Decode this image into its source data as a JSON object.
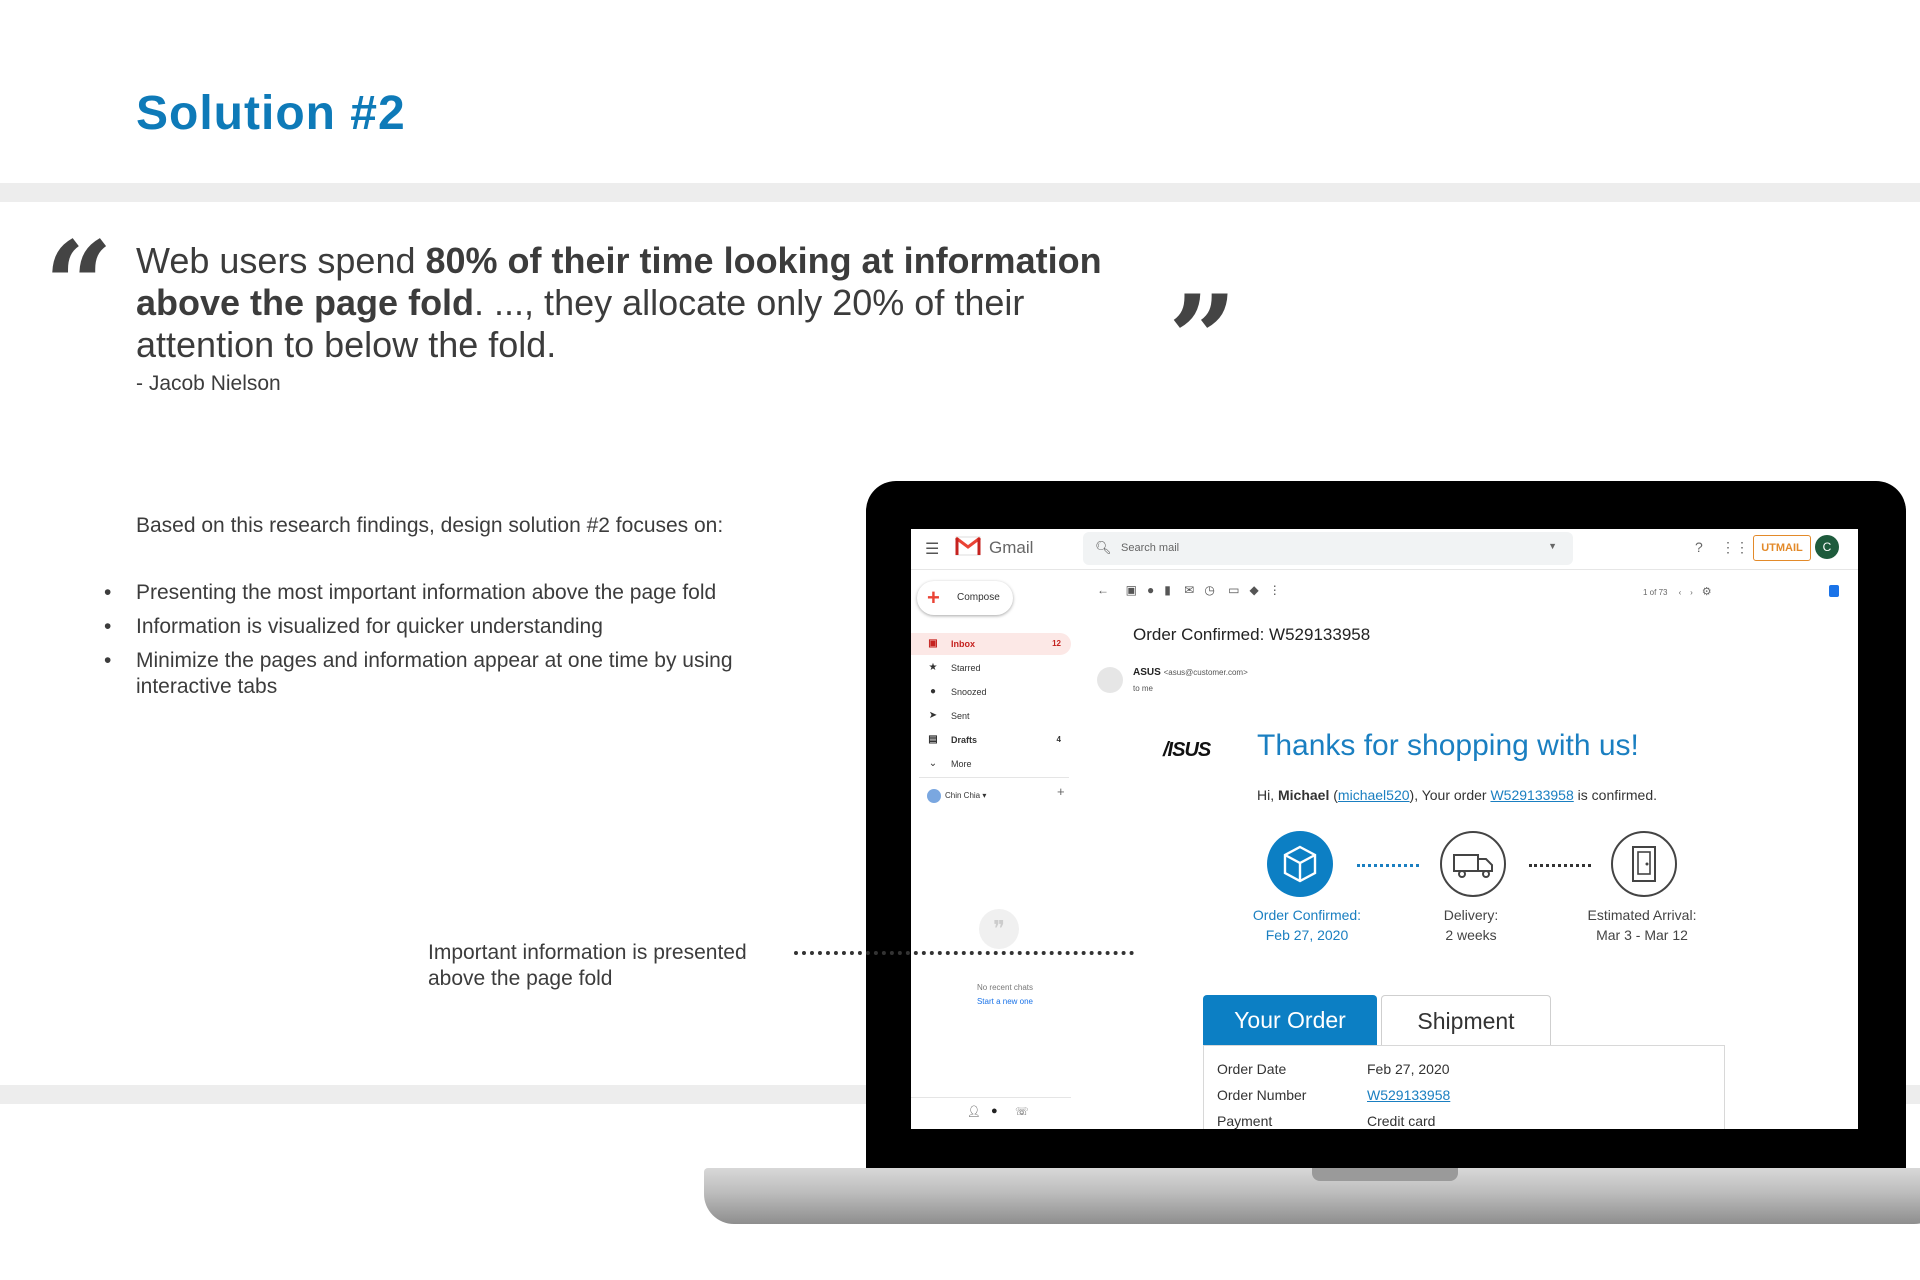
{
  "slide": {
    "title": "Solution #2",
    "quote_open": "“",
    "quote_close": "”",
    "quote": {
      "p1": "Web users spend ",
      "b1": "80% of their time looking at information above the page fold",
      "p2": ". ..., they allocate only 20% of their attention to below the fold."
    },
    "author": "- Jacob Nielson",
    "intro": "Based on this research findings, design solution #2 focuses on:",
    "bullet_glyph": "•",
    "bullets": [
      "Presenting the most important information above the page fold",
      "Information is visualized for quicker understanding",
      "Minimize the pages and information appear at one time by using interactive tabs"
    ],
    "callout": "Important information is presented above the page fold",
    "colors": {
      "title": "#0e7ab8",
      "band": "#ededed",
      "accent": "#0c7fc4"
    }
  },
  "gmail": {
    "app_name": "Gmail",
    "search_placeholder": "Search mail",
    "utm_badge": "UTMAIL",
    "avatar_letter": "C",
    "compose": "Compose",
    "nav": [
      {
        "label": "Inbox",
        "count": "12",
        "icon": "inbox-icon"
      },
      {
        "label": "Starred",
        "count": "",
        "icon": "star-icon"
      },
      {
        "label": "Snoozed",
        "count": "",
        "icon": "clock-icon"
      },
      {
        "label": "Sent",
        "count": "",
        "icon": "send-icon"
      },
      {
        "label": "Drafts",
        "count": "4",
        "icon": "draft-icon"
      },
      {
        "label": "More",
        "count": "",
        "icon": "chevron-down-icon"
      }
    ],
    "account": "Chin Chia",
    "no_chats": "No recent chats",
    "start_chat": "Start a new one",
    "pager": "1 of 73",
    "subject": "Order Confirmed: W529133958",
    "sender_name": "ASUS",
    "sender_addr": "<asus@customer.com>",
    "to": "to me"
  },
  "email": {
    "brand": "/ISUS",
    "headline": "Thanks for shopping with us!",
    "greet_pre": "Hi, ",
    "greet_name": "Michael",
    "greet_user": "michael520",
    "greet_mid": "), Your order ",
    "order_no": "W529133958",
    "greet_post": " is confirmed.",
    "steps": [
      {
        "label": "Order Confirmed:",
        "value": "Feb 27, 2020",
        "icon": "package-icon",
        "done": true
      },
      {
        "label": "Delivery:",
        "value": "2 weeks",
        "icon": "truck-icon",
        "done": false
      },
      {
        "label": "Estimated Arrival:",
        "value": "Mar 3 - Mar 12",
        "icon": "door-icon",
        "done": false
      }
    ],
    "tabs": [
      "Your Order",
      "Shipment"
    ],
    "rows": [
      {
        "label": "Order Date",
        "value": "Feb 27, 2020"
      },
      {
        "label": "Order Number",
        "value": "W529133958"
      },
      {
        "label": "Payment",
        "value": "Credit card"
      }
    ]
  }
}
